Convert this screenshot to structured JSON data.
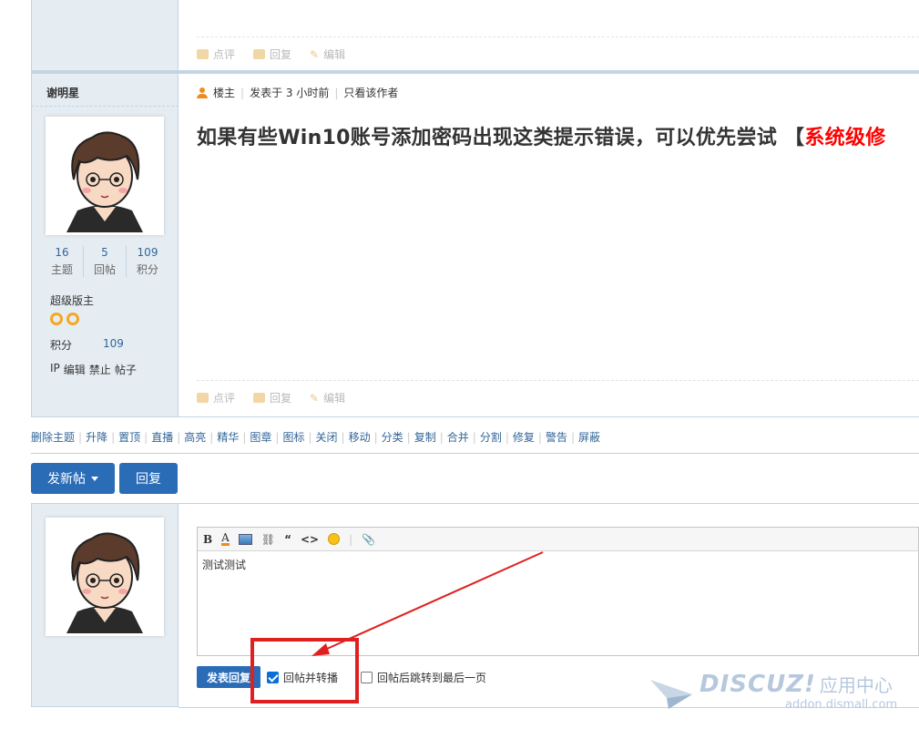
{
  "prev_post": {
    "actions": [
      "点评",
      "回复",
      "编辑"
    ]
  },
  "author": {
    "name": "谢明星",
    "stats": [
      {
        "num": "16",
        "label": "主题"
      },
      {
        "num": "5",
        "label": "回帖"
      },
      {
        "num": "109",
        "label": "积分"
      }
    ],
    "group": "超级版主",
    "credits_label": "积分",
    "credits_value": "109",
    "admin_links": [
      "IP",
      "编辑",
      "禁止",
      "帖子"
    ]
  },
  "post": {
    "role": "楼主",
    "posted": "发表于 3 小时前",
    "only_author": "只看该作者",
    "title_prefix": "如果有些Win10账号添加密码出现这类提示错误，可以优先尝试 【",
    "title_highlight": "系统级修",
    "actions": [
      "点评",
      "回复",
      "编辑"
    ]
  },
  "mod_actions": [
    "删除主题",
    "升降",
    "置顶",
    "直播",
    "高亮",
    "精华",
    "图章",
    "图标",
    "关闭",
    "移动",
    "分类",
    "复制",
    "合并",
    "分割",
    "修复",
    "警告",
    "屏蔽"
  ],
  "buttons": {
    "new_thread": "发新帖",
    "reply": "回复"
  },
  "editor": {
    "content": "测试测试",
    "submit": "发表回复",
    "opt_forward": "回帖并转播",
    "opt_forward_checked": true,
    "opt_jump": "回帖后跳转到最后一页",
    "opt_jump_checked": false
  },
  "watermark": {
    "brand": "DISCUZ!",
    "cn": "应用中心",
    "url": "addon.dismall.com"
  },
  "colors": {
    "accent": "#2b6cb7",
    "link": "#336699",
    "highlight_red": "#ff0000",
    "annotation_red": "#e02020",
    "side_bg": "#e5edf2"
  }
}
